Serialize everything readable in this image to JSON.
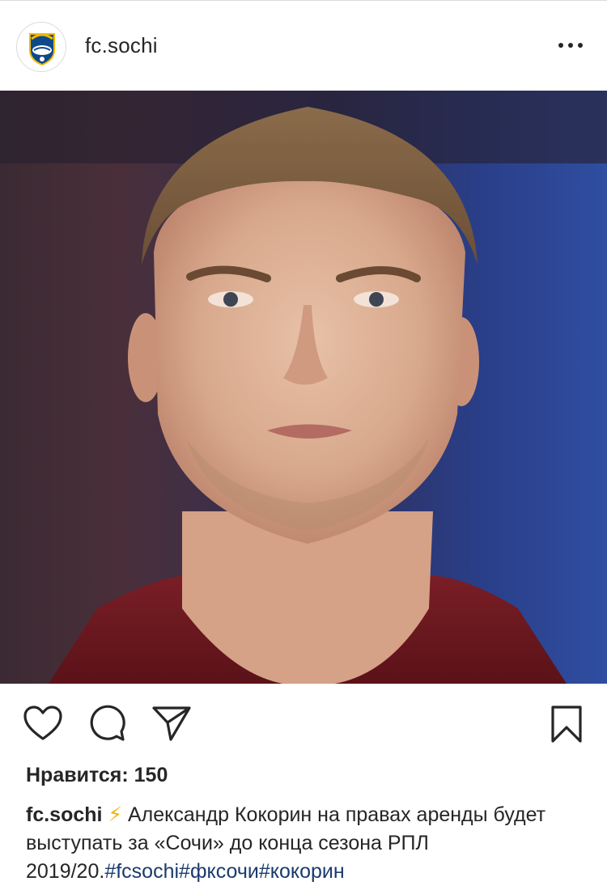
{
  "post": {
    "username": "fc.sochi",
    "avatar_icon": "fc-sochi-crest",
    "more_icon": "more-horizontal-icon",
    "photo_alt": "",
    "likes_label": "Нравится: 150",
    "caption": {
      "username": "fc.sochi",
      "emoji": "⚡",
      "text": " Александр Кокорин на правах аренды будет выступать за «Сочи» до конца сезона РПЛ 2019/20.",
      "hashtags": [
        "#fcsochi",
        "#фксочи",
        "#кокорин"
      ]
    }
  },
  "actions": {
    "like_icon": "heart-icon",
    "comment_icon": "comment-icon",
    "share_icon": "send-icon",
    "save_icon": "bookmark-icon"
  },
  "colors": {
    "text": "#262626",
    "hashtag": "#1a3b6d",
    "border": "#dbdbdb",
    "crest_blue": "#0c4a8a",
    "crest_gold": "#f2b705"
  }
}
